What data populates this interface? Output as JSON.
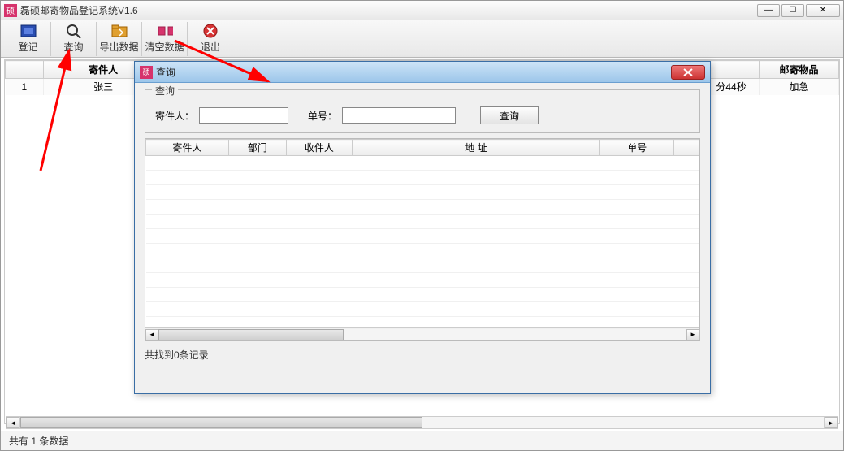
{
  "main_window": {
    "title": "磊硕邮寄物品登记系统V1.6",
    "app_icon_text": "硕"
  },
  "toolbar": {
    "register": "登记",
    "query": "查询",
    "export": "导出数据",
    "clear": "清空数据",
    "exit": "退出"
  },
  "main_table": {
    "headers": {
      "seq": "",
      "sender": "寄件人",
      "time_tail": "",
      "item": "邮寄物品"
    },
    "row": {
      "seq": "1",
      "sender": "张三",
      "time_tail": "分44秒",
      "item": "加急"
    }
  },
  "status": "共有 1 条数据",
  "dialog": {
    "title": "查询",
    "group_legend": "查询",
    "sender_label": "寄件人：",
    "order_label": "单号：",
    "sender_value": "",
    "order_value": "",
    "search_btn": "查询",
    "columns": {
      "sender": "寄件人",
      "dept": "部门",
      "recipient": "收件人",
      "address": "地 址",
      "order": "单号"
    },
    "result_status": "共找到0条记录"
  },
  "win_controls": {
    "minimize": "—",
    "maximize": "☐",
    "close": "✕"
  }
}
